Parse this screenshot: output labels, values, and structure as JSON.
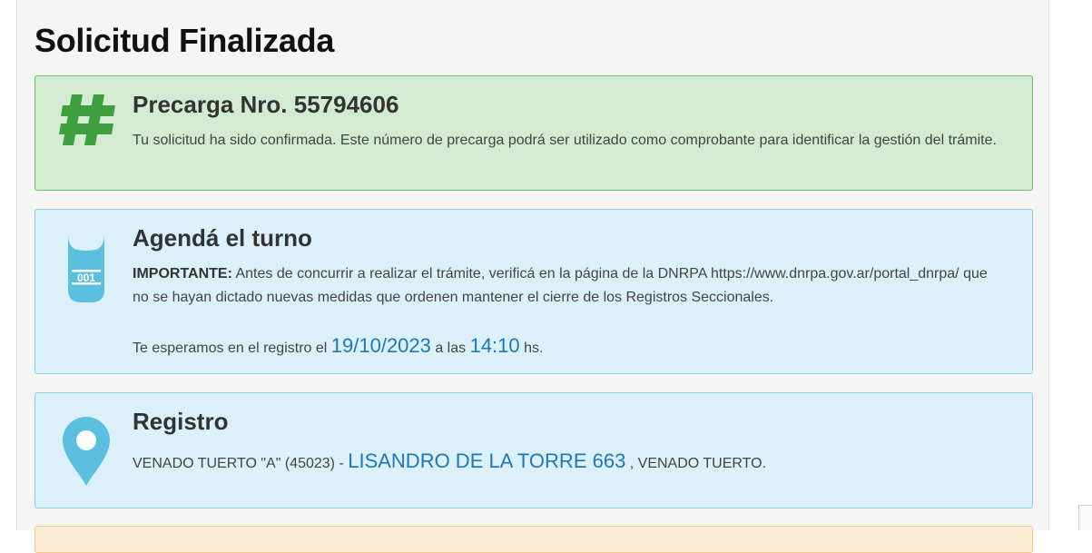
{
  "page": {
    "title": "Solicitud Finalizada"
  },
  "precarga": {
    "icon": "hash-icon",
    "title": "Precarga Nro. 55794606",
    "text": "Tu solicitud ha sido confirmada. Este número de precarga podrá ser utilizado como comprobante para identificar la gestión del trámite."
  },
  "turno": {
    "icon": "ticket-icon",
    "ticket_number": "001",
    "title": "Agendá el turno",
    "important_label": "IMPORTANTE:",
    "important_text": " Antes de concurrir a realizar el trámite, verificá en la página de la DNRPA https://www.dnrpa.gov.ar/portal_dnrpa/ que no se hayan dictado nuevas medidas que ordenen mantener el cierre de los Registros Seccionales.",
    "esperamos_prefix": "Te esperamos en el registro el ",
    "date": "19/10/2023",
    "a_las": " a las ",
    "time": "14:10",
    "hs": " hs."
  },
  "registro": {
    "icon": "map-pin-icon",
    "title": "Registro",
    "name": "VENADO TUERTO \"A\" (45023) - ",
    "address": "LISANDRO DE LA TORRE 663",
    "city": " , VENADO TUERTO."
  },
  "colors": {
    "success_bg": "#d3ebd3",
    "success_border": "#6cc06c",
    "success_icon": "#3f9f3f",
    "info_bg": "#dbf0f8",
    "info_border": "#8fcfea",
    "info_icon": "#5bc0e0",
    "link_blue": "#1e78b8"
  }
}
